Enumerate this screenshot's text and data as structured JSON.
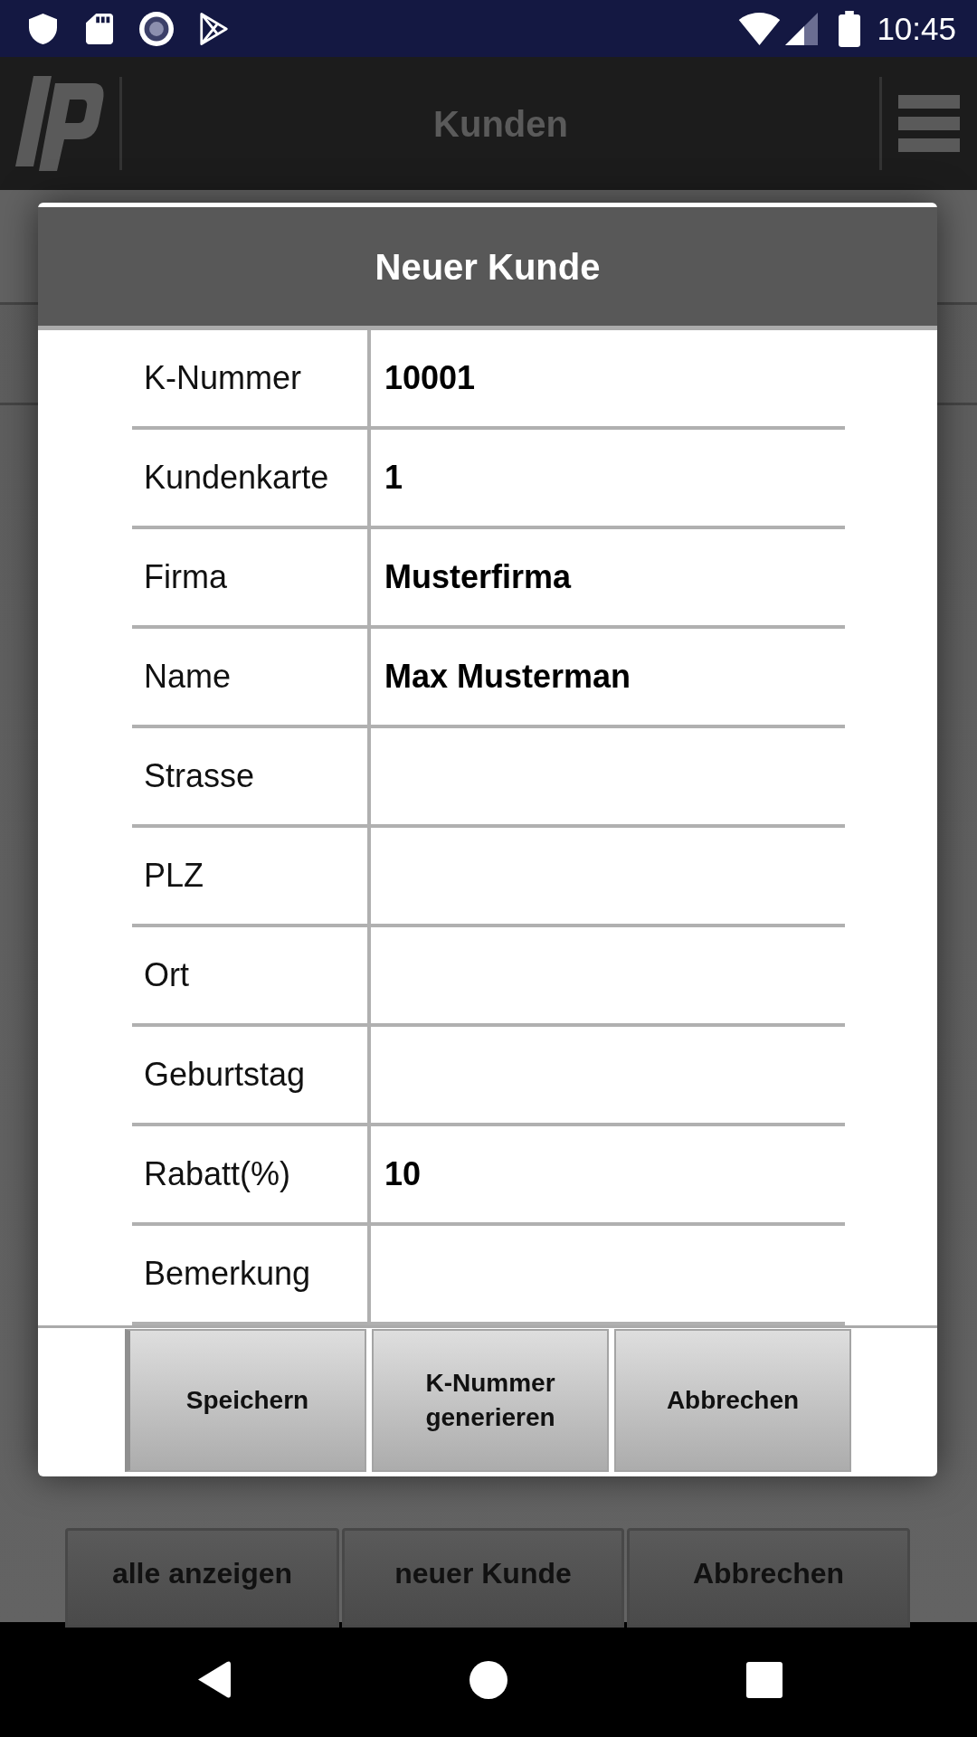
{
  "status_bar": {
    "time": "10:45"
  },
  "app_bar": {
    "title": "Kunden"
  },
  "dialog": {
    "title": "Neuer Kunde",
    "fields": [
      {
        "label": "K-Nummer",
        "value": "10001"
      },
      {
        "label": "Kundenkarte",
        "value": "1"
      },
      {
        "label": "Firma",
        "value": "Musterfirma"
      },
      {
        "label": "Name",
        "value": "Max Musterman"
      },
      {
        "label": "Strasse"
      },
      {
        "label": "PLZ"
      },
      {
        "label": "Ort"
      },
      {
        "label": "Geburtstag"
      },
      {
        "label": "Rabatt(%)",
        "value": "10"
      },
      {
        "label": "Bemerkung"
      }
    ],
    "buttons": [
      "Speichern",
      "K-Nummer generieren",
      "Abbrechen"
    ]
  },
  "page_buttons": [
    "alle anzeigen",
    "neuer Kunde",
    "Abbrechen"
  ]
}
